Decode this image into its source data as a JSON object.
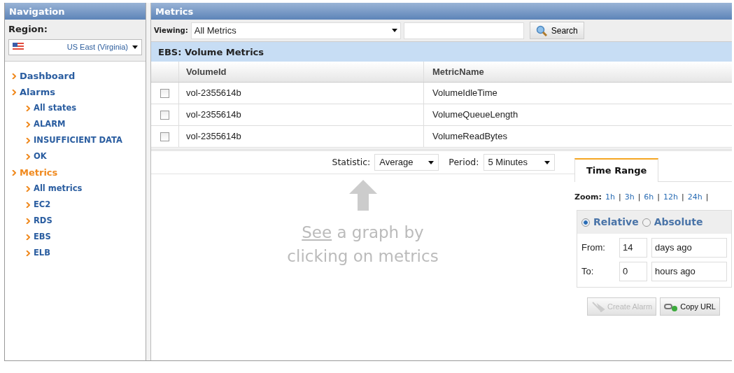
{
  "navigation": {
    "title": "Navigation",
    "region_label": "Region:",
    "region": "US East (Virginia)",
    "items": [
      {
        "label": "Dashboard",
        "selected": false
      },
      {
        "label": "Alarms",
        "selected": false,
        "children": [
          {
            "label": "All states",
            "selected": false
          },
          {
            "label": "ALARM",
            "selected": false
          },
          {
            "label": "INSUFFICIENT DATA",
            "selected": false
          },
          {
            "label": "OK",
            "selected": false
          }
        ]
      },
      {
        "label": "Metrics",
        "selected": true,
        "children": [
          {
            "label": "All metrics",
            "selected": false
          },
          {
            "label": "EC2",
            "selected": false
          },
          {
            "label": "RDS",
            "selected": false
          },
          {
            "label": "EBS",
            "selected": false
          },
          {
            "label": "ELB",
            "selected": false
          }
        ]
      }
    ]
  },
  "metrics": {
    "title": "Metrics",
    "viewing_label": "Viewing:",
    "viewing": "All Metrics",
    "search_button": "Search",
    "table": {
      "title": "EBS: Volume Metrics",
      "columns": [
        "VolumeId",
        "MetricName"
      ],
      "rows": [
        {
          "checked": false,
          "cells": [
            "vol-2355614b",
            "VolumeIdleTime"
          ]
        },
        {
          "checked": false,
          "cells": [
            "vol-2355614b",
            "VolumeQueueLength"
          ]
        },
        {
          "checked": false,
          "cells": [
            "vol-2355614b",
            "VolumeReadBytes"
          ]
        }
      ]
    }
  },
  "graph": {
    "statistic_label": "Statistic:",
    "statistic": "Average",
    "period_label": "Period:",
    "period": "5 Minutes",
    "hint_link": "See",
    "hint_text": "a graph by clicking on metrics"
  },
  "time_range": {
    "tabs": [
      {
        "label": "Time Range",
        "selected": true
      }
    ],
    "zoom_label": "Zoom:",
    "zoom_separator": "|",
    "zoom": [
      "1h",
      "3h",
      "6h",
      "12h",
      "24h"
    ],
    "modes": [
      {
        "label": "Relative",
        "selected": true
      },
      {
        "label": "Absolute",
        "selected": false
      }
    ],
    "from_label": "From:",
    "from_value": "14",
    "from_unit": "days ago",
    "to_label": "To:",
    "to_value": "0",
    "to_unit": "hours ago",
    "buttons": [
      {
        "kind": "alarm",
        "label": "Create Alarm",
        "disabled": true
      },
      {
        "kind": "link",
        "label": "Copy URL",
        "disabled": false
      }
    ]
  }
}
